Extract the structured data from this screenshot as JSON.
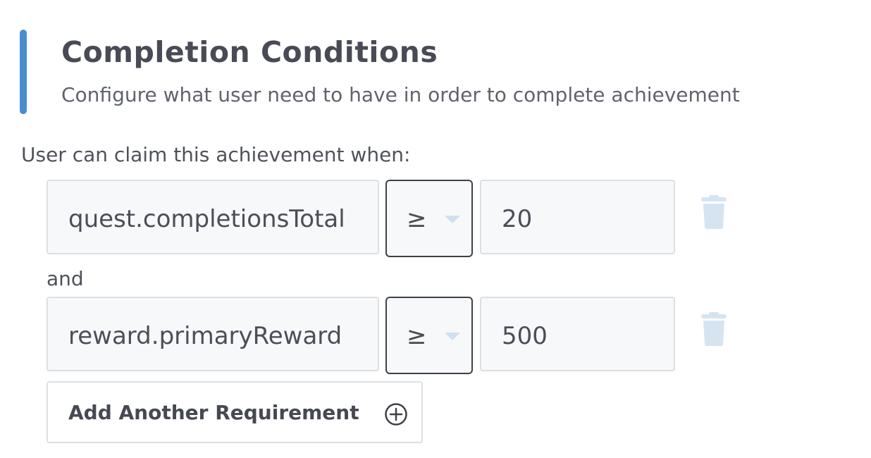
{
  "section": {
    "title": "Completion Conditions",
    "subtitle": "Configure what user need to have in order to complete achievement",
    "accent_color": "#4a8ccf"
  },
  "claim_intro": "User can claim this achievement when:",
  "conditions": [
    {
      "field": "quest.completionsTotal",
      "operator": "≥",
      "value": "20",
      "delete_icon": "trash-icon"
    },
    {
      "field": "reward.primaryReward",
      "operator": "≥",
      "value": "500",
      "delete_icon": "trash-icon"
    }
  ],
  "connector": "and",
  "add_button": {
    "label": "Add Another Requirement",
    "icon": "plus-circle-icon"
  },
  "colors": {
    "text": "#4a4d57",
    "field_bg": "#f7f8fa",
    "field_border": "#dcdfe3",
    "trash_icon": "#d6e4f1"
  }
}
